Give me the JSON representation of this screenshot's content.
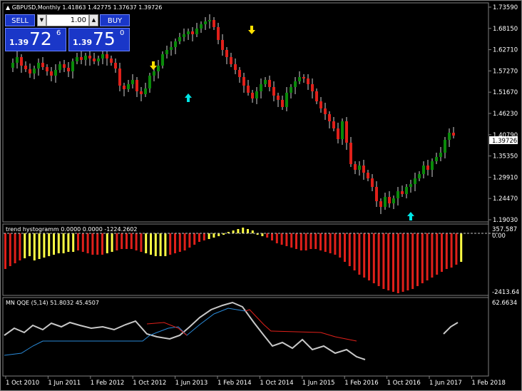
{
  "chart": {
    "header": "GBPUSD,Monthly  1.41863 1.42775 1.37637 1.39726",
    "symbol": "GBPUSD",
    "timeframe": "Monthly",
    "open": "1.41863",
    "high": "1.42775",
    "low": "1.37637",
    "close": "1.39726",
    "price_axis": [
      "1.73590",
      "1.68150",
      "1.62710",
      "1.57270",
      "1.51670",
      "1.46230",
      "1.40790",
      "1.35350",
      "1.29910",
      "1.24470",
      "1.19030"
    ],
    "current_price": "1.39726",
    "time_axis": [
      "1 Oct 2010",
      "1 Jun 2011",
      "1 Feb 2012",
      "1 Oct 2012",
      "1 Jun 2013",
      "1 Feb 2014",
      "1 Oct 2014",
      "1 Jun 2015",
      "1 Feb 2016",
      "1 Oct 2016",
      "1 Jun 2017",
      "1 Feb 2018"
    ],
    "colors": {
      "background": "#000000",
      "bull": "#0a8a0a",
      "bear": "#e0201a",
      "arrow_up": "#00e5e5",
      "arrow_down": "#ffe000",
      "axis_text": "#ffffff"
    }
  },
  "trading_panel": {
    "sell_label": "SELL",
    "buy_label": "BUY",
    "lot": "1.00",
    "sell_small": "1.39",
    "sell_big": "72",
    "sell_sup": "6",
    "buy_small": "1.39",
    "buy_big": "75",
    "buy_sup": "0"
  },
  "histogram": {
    "header": "trend hystogramm 0.0000 0.0000 -1224.2602",
    "axis_top": "357.587",
    "axis_zero": "0.00",
    "axis_bottom": "-2413.64",
    "colors": {
      "positive": "#ffff44",
      "negative": "#e0201a"
    }
  },
  "qqe": {
    "header": "MN  QQE (5,14) 51.8032 45.4507",
    "axis_top": "62.6634",
    "colors": {
      "line": "#c8c8c8",
      "slow": "#2a8ad8",
      "trailing": "#e0201a"
    }
  }
}
